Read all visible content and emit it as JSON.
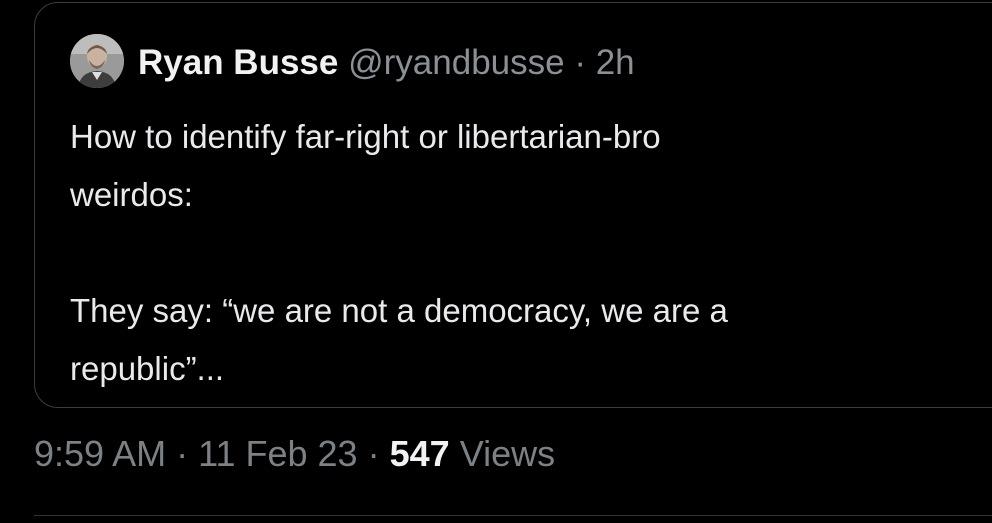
{
  "quoted_tweet": {
    "author_name": "Ryan Busse",
    "author_handle": "@ryandbusse",
    "separator": "·",
    "relative_time": "2h",
    "text_lines": [
      "How to identify far-right or libertarian-bro",
      "weirdos:",
      "",
      "They say: “we are not a democracy, we are a",
      "republic”..."
    ]
  },
  "tweet_meta": {
    "time": "9:59 AM",
    "separator_1": "·",
    "date": "11 Feb 23",
    "separator_2": "·",
    "views_count": "547",
    "views_label": "Views"
  },
  "colors": {
    "background": "#000000",
    "primary_text": "#e7e9ea",
    "secondary_text": "#8b9096",
    "border": "#3a3d40"
  }
}
